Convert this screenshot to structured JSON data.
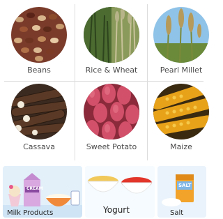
{
  "categories": [
    {
      "label": "Beans"
    },
    {
      "label": "Rice & Wheat"
    },
    {
      "label": "Pearl Millet"
    },
    {
      "label": "Cassava"
    },
    {
      "label": "Sweet Potato"
    },
    {
      "label": "Maize"
    }
  ],
  "cards": [
    {
      "label": "Milk Products",
      "badge": "CREAM"
    },
    {
      "label": "Yogurt"
    },
    {
      "label": "Salt",
      "badge": "SALT"
    }
  ]
}
